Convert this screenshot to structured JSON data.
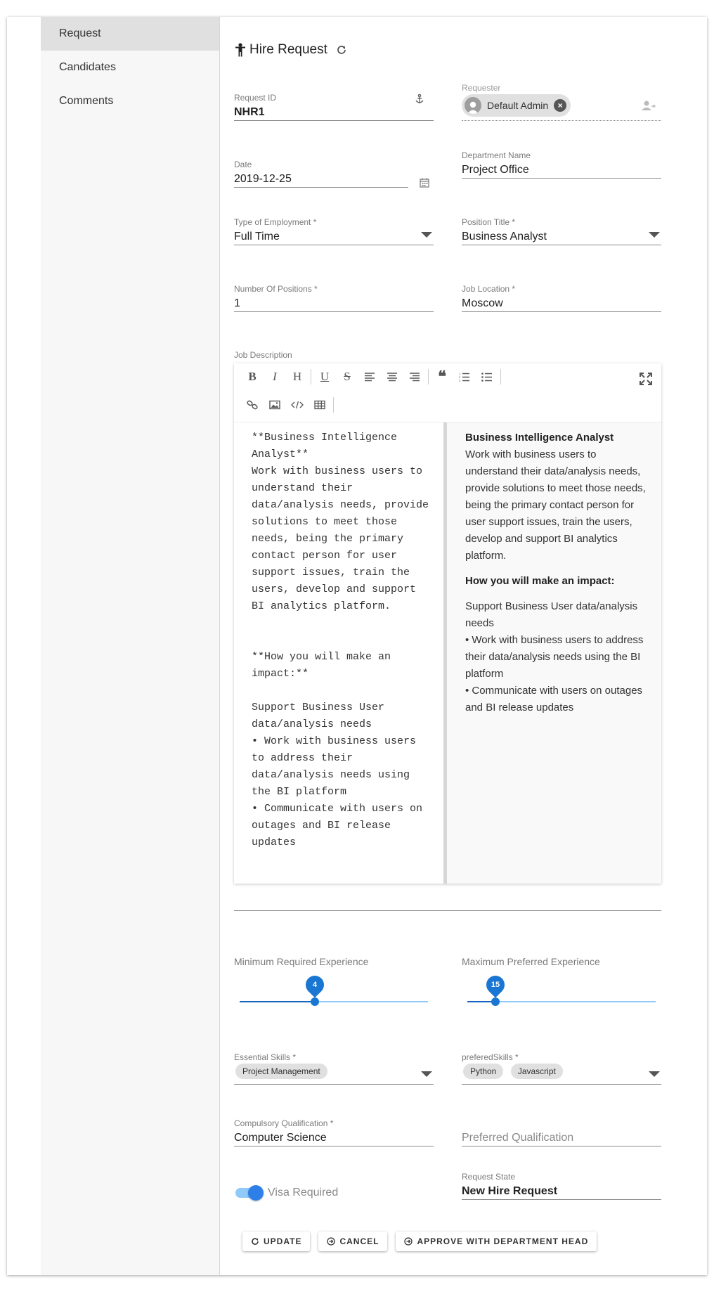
{
  "sidebar": {
    "items": [
      {
        "label": "Request",
        "active": true
      },
      {
        "label": "Candidates",
        "active": false
      },
      {
        "label": "Comments",
        "active": false
      }
    ]
  },
  "header": {
    "title": "Hire Request",
    "icon": "person-icon",
    "refresh_icon": "refresh-icon"
  },
  "form": {
    "request_id": {
      "label": "Request ID",
      "value": "NHR1"
    },
    "requester": {
      "label": "Requester",
      "value": "Default Admin"
    },
    "date": {
      "label": "Date",
      "value": "2019-12-25"
    },
    "department": {
      "label": "Department Name",
      "value": "Project Office"
    },
    "employment_type": {
      "label": "Type of Employment *",
      "value": "Full Time"
    },
    "position_title": {
      "label": "Position Title *",
      "value": "Business Analyst"
    },
    "positions": {
      "label": "Number Of Positions *",
      "value": "1"
    },
    "location": {
      "label": "Job Location *",
      "value": "Moscow"
    },
    "essential_skills": {
      "label": "Essential Skills *",
      "chips": [
        "Project Management"
      ]
    },
    "preferred_skills": {
      "label": "preferedSkills *",
      "chips": [
        "Python",
        "Javascript"
      ]
    },
    "compulsory_qualification": {
      "label": "Compulsory Qualification *",
      "value": "Computer Science"
    },
    "preferred_qualification": {
      "placeholder": "Preferred Qualification"
    },
    "visa": {
      "label": "Visa Required",
      "checked": true
    },
    "request_state": {
      "label": "Request State",
      "value": "New Hire Request"
    }
  },
  "editor": {
    "label": "Job Description",
    "markdown_lines": [
      "**Business Intelligence",
      "Analyst**",
      "Work with business users to",
      "understand their",
      "data/analysis needs, provide",
      "solutions to meet those",
      "needs, being the primary",
      "contact person for user",
      "support issues, train the",
      "users, develop and support",
      "BI analytics platform.",
      "",
      "",
      "**How you will make an",
      "impact:**",
      "",
      "Support Business User",
      "data/analysis needs",
      "• Work with business users",
      "to address their",
      "data/analysis needs using",
      "the BI platform",
      "• Communicate with users on",
      "outages and BI release",
      "updates"
    ],
    "preview": {
      "heading1": "Business Intelligence Analyst",
      "para1": "Work with business users to understand their data/analysis needs, provide solutions to meet those needs, being the primary contact person for user support issues, train the users, develop and support BI analytics platform.",
      "heading2": "How you will make an impact:",
      "para2a": "Support Business User data/analysis needs",
      "para2b": "• Work with business users to address their data/analysis needs using the BI platform",
      "para2c": "• Communicate with users on outages and BI release updates"
    }
  },
  "experience": {
    "min": {
      "label": "Minimum Required Experience",
      "value": "4",
      "fraction": 0.4
    },
    "max": {
      "label": "Maximum Preferred Experience",
      "value": "15",
      "fraction": 0.15
    }
  },
  "actions": {
    "update": "UPDATE",
    "cancel": "CANCEL",
    "approve": "APPROVE WITH DEPARTMENT HEAD"
  },
  "colors": {
    "accent": "#1976d2",
    "track": "#90caf9"
  }
}
